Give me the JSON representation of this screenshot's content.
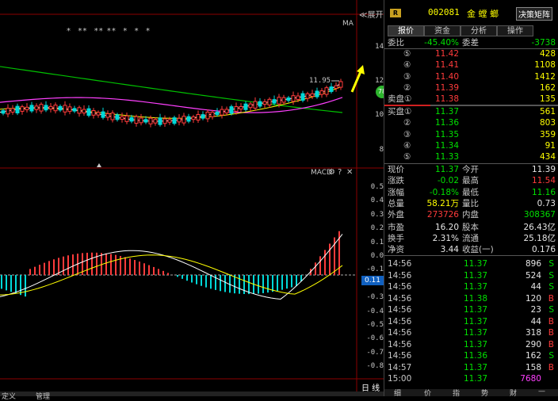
{
  "chart": {
    "ma_label": "MA",
    "star_marks": "*  **  ** **  *  *  *",
    "expand_button": "≪展开",
    "last_price_tag": "11.95",
    "macd_label": "MACD",
    "current_macd_value": "0.11",
    "price_axis": [
      "14",
      "12",
      "10",
      "8"
    ],
    "macd_axis": [
      "0.5",
      "0.4",
      "0.3",
      "0.2",
      "0.1",
      "0.0",
      "-0.1",
      "-0.2",
      "-0.3",
      "-0.4",
      "-0.5",
      "-0.6",
      "-0.7",
      "-0.8"
    ],
    "period_label": "日 线",
    "bottom_tabs": [
      "定义",
      "管理"
    ],
    "colors": {
      "up": "#ff3b3b",
      "down": "#00d8d8",
      "ma1": "#ffffff",
      "ma2": "#ffff00",
      "ma3": "#ff40ff",
      "ma4": "#00c000"
    }
  },
  "panel": {
    "badge": "R",
    "code": "002081",
    "name": "金 螳 螂",
    "decision_button": "决策矩阵",
    "tabs": [
      "报价",
      "资金",
      "分析",
      "操作"
    ],
    "weibi": {
      "label": "委比",
      "value": "-45.40%",
      "label2": "委差",
      "value2": "-3738"
    },
    "asks": [
      {
        "label": "⑤",
        "price": "11.42",
        "vol": "428"
      },
      {
        "label": "④",
        "price": "11.41",
        "vol": "1108"
      },
      {
        "label": "③",
        "price": "11.40",
        "vol": "1412"
      },
      {
        "label": "②",
        "price": "11.39",
        "vol": "162"
      },
      {
        "label": "卖盘①",
        "price": "11.38",
        "vol": "135"
      }
    ],
    "bids": [
      {
        "label": "买盘①",
        "price": "11.37",
        "vol": "561"
      },
      {
        "label": "②",
        "price": "11.36",
        "vol": "803"
      },
      {
        "label": "③",
        "price": "11.35",
        "vol": "359"
      },
      {
        "label": "④",
        "price": "11.34",
        "vol": "91"
      },
      {
        "label": "⑤",
        "price": "11.33",
        "vol": "434"
      }
    ],
    "stats": [
      {
        "l1": "现价",
        "v1": "11.37",
        "c1": "green",
        "l2": "今开",
        "v2": "11.39",
        "c2": "white"
      },
      {
        "l1": "涨跌",
        "v1": "-0.02",
        "c1": "green",
        "l2": "最高",
        "v2": "11.54",
        "c2": "red"
      },
      {
        "l1": "涨幅",
        "v1": "-0.18%",
        "c1": "green",
        "l2": "最低",
        "v2": "11.16",
        "c2": "green"
      },
      {
        "l1": "总量",
        "v1": "58.21万",
        "c1": "yellow",
        "l2": "量比",
        "v2": "0.73",
        "c2": "white"
      },
      {
        "l1": "外盘",
        "v1": "273726",
        "c1": "red",
        "l2": "内盘",
        "v2": "308367",
        "c2": "green"
      },
      {
        "l1": "市盈",
        "v1": "16.20",
        "c1": "white",
        "l2": "股本",
        "v2": "26.43亿",
        "c2": "white"
      },
      {
        "l1": "换手",
        "v1": "2.31%",
        "c1": "white",
        "l2": "流通",
        "v2": "25.18亿",
        "c2": "white"
      },
      {
        "l1": "净资",
        "v1": "3.44",
        "c1": "white",
        "l2": "收益(一)",
        "v2": "0.176",
        "c2": "white"
      }
    ],
    "trades": [
      {
        "time": "14:56",
        "price": "11.37",
        "pc": "green",
        "vol": "896",
        "vc": "white",
        "flag": "S",
        "fc": "green"
      },
      {
        "time": "14:56",
        "price": "11.37",
        "pc": "green",
        "vol": "524",
        "vc": "white",
        "flag": "S",
        "fc": "green"
      },
      {
        "time": "14:56",
        "price": "11.37",
        "pc": "green",
        "vol": "44",
        "vc": "white",
        "flag": "S",
        "fc": "green"
      },
      {
        "time": "14:56",
        "price": "11.38",
        "pc": "green",
        "vol": "120",
        "vc": "white",
        "flag": "B",
        "fc": "red"
      },
      {
        "time": "14:56",
        "price": "11.37",
        "pc": "green",
        "vol": "23",
        "vc": "white",
        "flag": "S",
        "fc": "green"
      },
      {
        "time": "14:56",
        "price": "11.37",
        "pc": "green",
        "vol": "44",
        "vc": "white",
        "flag": "B",
        "fc": "red"
      },
      {
        "time": "14:56",
        "price": "11.37",
        "pc": "green",
        "vol": "318",
        "vc": "white",
        "flag": "B",
        "fc": "red"
      },
      {
        "time": "14:56",
        "price": "11.37",
        "pc": "green",
        "vol": "290",
        "vc": "white",
        "flag": "B",
        "fc": "red"
      },
      {
        "time": "14:56",
        "price": "11.36",
        "pc": "green",
        "vol": "162",
        "vc": "white",
        "flag": "S",
        "fc": "green"
      },
      {
        "time": "14:57",
        "price": "11.37",
        "pc": "green",
        "vol": "158",
        "vc": "white",
        "flag": "B",
        "fc": "red"
      },
      {
        "time": "15:00",
        "price": "11.37",
        "pc": "green",
        "vol": "7680",
        "vc": "magenta",
        "flag": "",
        "fc": "white"
      }
    ],
    "bottom_tabs": [
      "细",
      "价",
      "指",
      "势",
      "财",
      "—"
    ]
  }
}
